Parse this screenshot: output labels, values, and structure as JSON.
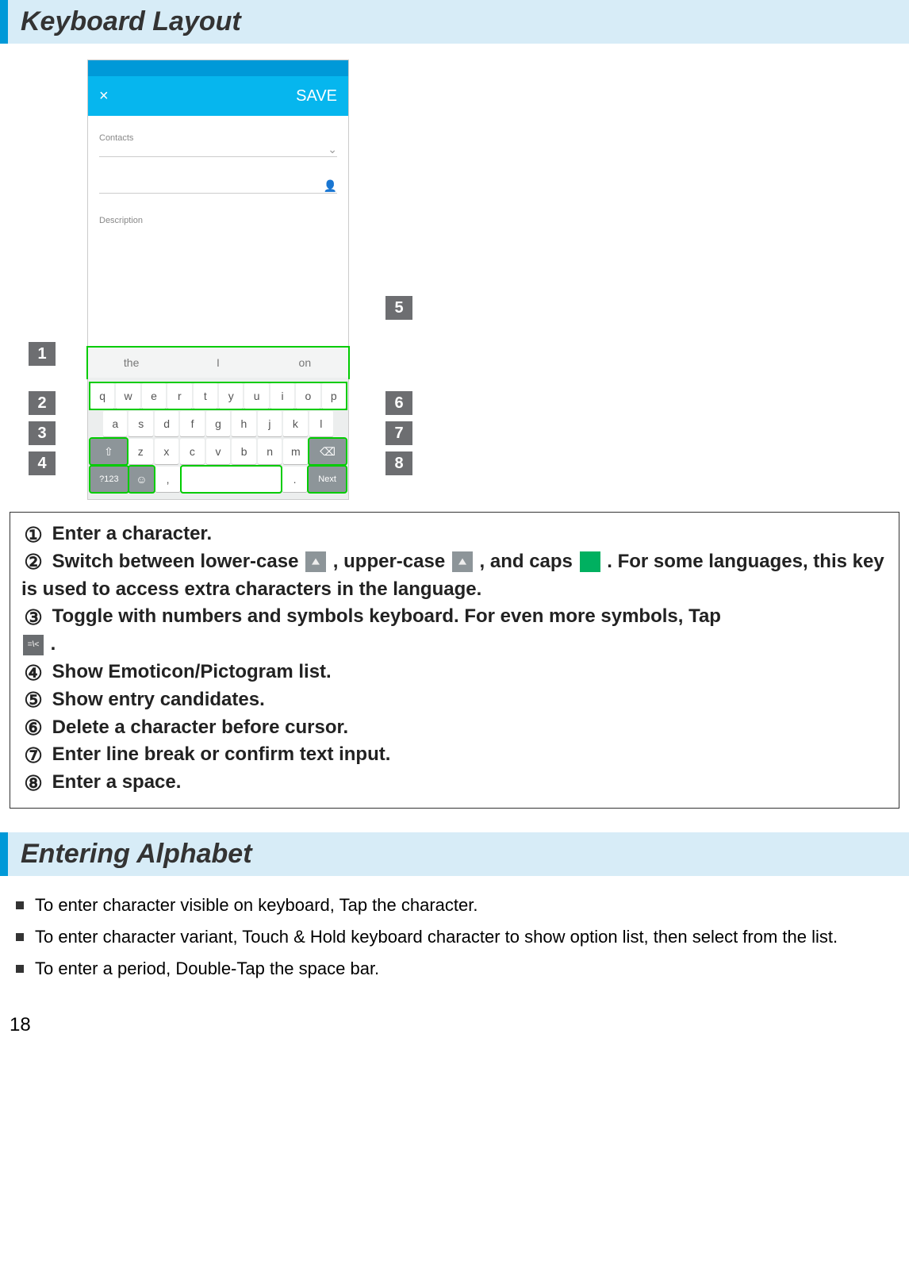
{
  "sections": {
    "keyboard_layout": {
      "title": "Keyboard Layout"
    },
    "entering_alphabet": {
      "title": "Entering Alphabet"
    }
  },
  "phone": {
    "appbar_left": "×",
    "appbar_right": "SAVE",
    "label_contacts": "Contacts",
    "sug1": "the",
    "sug2": "I",
    "sug3": "on",
    "row1": [
      "q",
      "w",
      "e",
      "r",
      "t",
      "y",
      "u",
      "i",
      "o",
      "p"
    ],
    "row2": [
      "a",
      "s",
      "d",
      "f",
      "g",
      "h",
      "j",
      "k",
      "l"
    ],
    "row3_mid": [
      "z",
      "x",
      "c",
      "v",
      "b",
      "n",
      "m"
    ],
    "sym_key": "?123",
    "next_key": "Next"
  },
  "callouts": {
    "1": "1",
    "2": "2",
    "3": "3",
    "4": "4",
    "5": "5",
    "6": "6",
    "7": "7",
    "8": "8"
  },
  "legend": {
    "l1": "Enter a character.",
    "l2a": "Switch between lower-case ",
    "l2b": ", upper-case ",
    "l2c": ", and caps ",
    "l2d": ". For some languages, this key is used to access extra characters in the language.",
    "l3a": "Toggle with numbers and symbols keyboard. For even more symbols, Tap ",
    "l3b": ".",
    "l4": "Show Emoticon/Pictogram list.",
    "l5": "Show entry candidates.",
    "l6": "Delete a character before cursor.",
    "l7": "Enter line break or confirm text input.",
    "l8": "Enter a space.",
    "circles": {
      "1": "①",
      "2": "②",
      "3": "③",
      "4": "④",
      "5": "⑤",
      "6": "⑥",
      "7": "⑦",
      "8": "⑧"
    }
  },
  "bullets": [
    "To enter character visible on keyboard, Tap the character.",
    "To enter character variant, Touch & Hold keyboard character to show option list, then select from the list.",
    "To enter a period, Double-Tap the space bar."
  ],
  "page_number": "18"
}
